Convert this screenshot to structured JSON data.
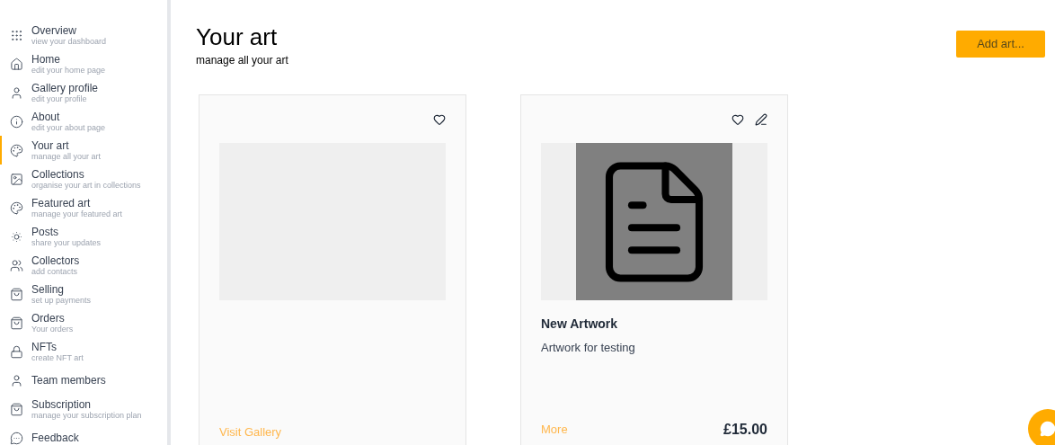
{
  "sidebar": {
    "items": [
      {
        "label": "Overview",
        "sub": "view your dashboard",
        "selected": false
      },
      {
        "label": "Home",
        "sub": "edit your home page",
        "selected": false
      },
      {
        "label": "Gallery profile",
        "sub": "edit your profile",
        "selected": false
      },
      {
        "label": "About",
        "sub": "edit your about page",
        "selected": false
      },
      {
        "label": "Your art",
        "sub": "manage all your art",
        "selected": true
      },
      {
        "label": "Collections",
        "sub": "organise your art in collections",
        "selected": false
      },
      {
        "label": "Featured art",
        "sub": "manage your featured art",
        "selected": false
      },
      {
        "label": "Posts",
        "sub": "share your updates",
        "selected": false
      },
      {
        "label": "Collectors",
        "sub": "add contacts",
        "selected": false
      },
      {
        "label": "Selling",
        "sub": "set up payments",
        "selected": false
      },
      {
        "label": "Orders",
        "sub": "Your orders",
        "selected": false
      },
      {
        "label": "NFTs",
        "sub": "create NFT art",
        "selected": false
      },
      {
        "label": "Team members",
        "selected": false
      },
      {
        "label": "Subscription",
        "sub": "manage your subscription plan",
        "selected": false
      },
      {
        "label": "Feedback",
        "selected": false
      }
    ]
  },
  "header": {
    "title": "Your art",
    "subtitle": "manage all your art",
    "button": "Add art..."
  },
  "cards": [
    {
      "kind": "placeholder",
      "editable": false,
      "link": "Visit Gallery"
    },
    {
      "kind": "artwork",
      "editable": true,
      "title": "New Artwork",
      "description": "Artwork for testing",
      "link": "More",
      "price": "£15.00"
    }
  ]
}
